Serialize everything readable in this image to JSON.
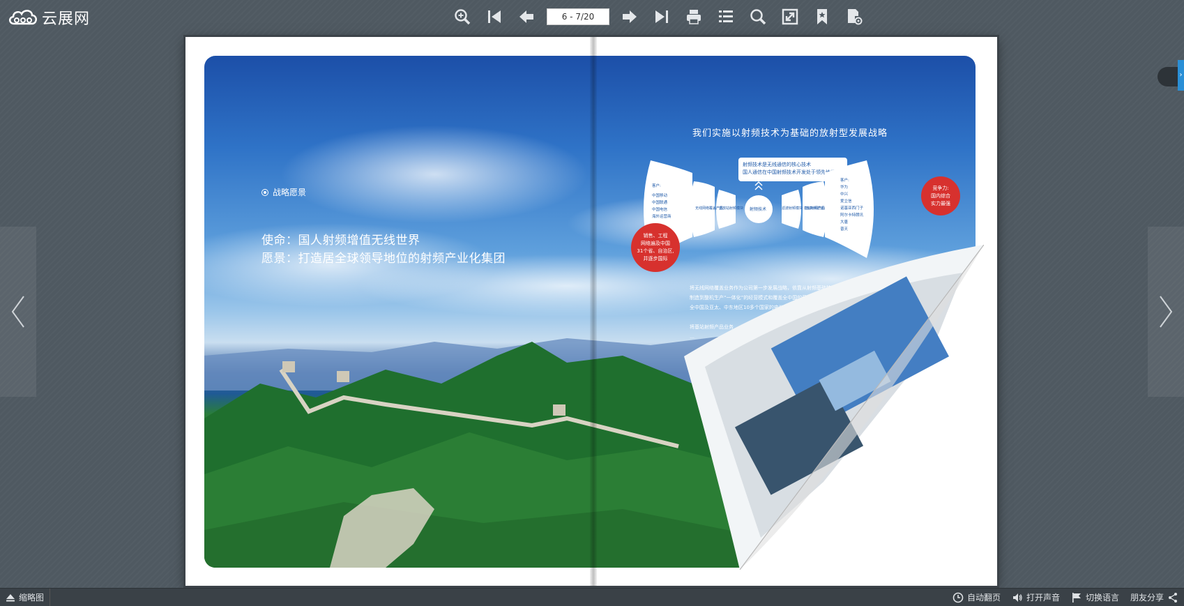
{
  "app": {
    "logo_text": "云展网"
  },
  "toolbar": {
    "buttons": [
      "zoom-in",
      "first-page",
      "prev-page",
      "next-page",
      "last-page",
      "print",
      "table-of-contents",
      "search",
      "fullscreen",
      "bookmark",
      "settings"
    ],
    "page_indicator": "6 - 7/20"
  },
  "book": {
    "left_page": {
      "section_header": "战略愿景",
      "mission_line": "使命：国人射频增值无线世界",
      "vision_line": "愿景：打造居全球领导地位的射频产业化集团"
    },
    "right_page": {
      "strategy_title": "我们实施以射频技术为基础的放射型发展战略",
      "info_box_line1": "射频技术是无线通信的核心技术",
      "info_box_line2": "国人通信在中国射频技术开发处于领先地位",
      "center_node": "射频技术",
      "left_customers": [
        "客户:",
        "中国移动",
        "中国联通",
        "中国电信",
        "海外运营商"
      ],
      "right_customers": [
        "客户:",
        "华为",
        "中兴",
        "爱立信",
        "诺基亚西门子",
        "阿尔卡特朗讯",
        "大唐",
        "普天"
      ],
      "segments": [
        "无线网络覆盖产品",
        "直放站射频模块",
        "滤波射频模块（含高频滤波）",
        "基站射频产品"
      ],
      "left_red_circle": [
        "销售、工程",
        "网络遍及中国",
        "31个省、自治区,",
        "并逐步国际"
      ],
      "right_red_circle": [
        "竞争力:",
        "国内综合",
        "实力最强"
      ],
      "bullet1_lines": [
        "将无线网络覆盖业务作为公司第一步发展战略，依靠从射频基础技术开发、模块",
        "制造到整机生产“一体化”的经营模式和覆盖全中国的营销和工程",
        "全中国及亚太、中东地区10多个国家的电信运营商提供"
      ],
      "bullet2_lines": [
        "将基站射频产品业务",
        "…"
      ]
    }
  },
  "bottom_bar": {
    "thumbnail_label": "缩略图",
    "auto_flip_label": "自动翻页",
    "sound_label": "打开声音",
    "language_label": "切换语言",
    "share_label": "朋友分享"
  },
  "colors": {
    "background": "#4f5961",
    "toolbar_icon": "#e4e7ea",
    "accent_red": "#d7312e",
    "side_tab_blue": "#2a8fd6"
  }
}
